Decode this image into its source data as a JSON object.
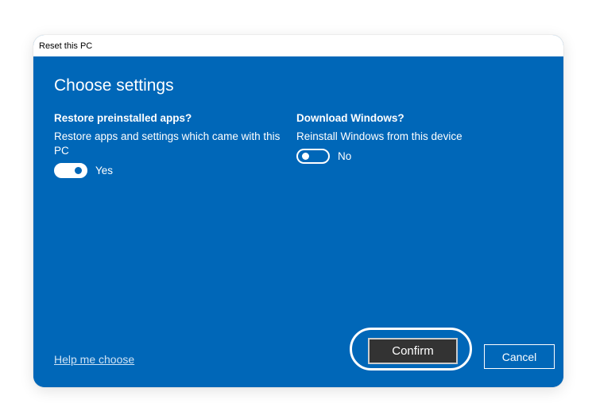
{
  "window": {
    "title": "Reset this PC"
  },
  "heading": "Choose settings",
  "restore": {
    "title": "Restore preinstalled apps?",
    "description": "Restore apps and settings which came with this PC",
    "toggle_state": "Yes",
    "toggle_on": true
  },
  "download": {
    "title": "Download Windows?",
    "description": "Reinstall Windows from this device",
    "toggle_state": "No",
    "toggle_on": false
  },
  "footer": {
    "help_link": "Help me choose",
    "confirm_label": "Confirm",
    "cancel_label": "Cancel"
  },
  "colors": {
    "accent": "#0067b8",
    "confirm_bg": "#333333"
  }
}
